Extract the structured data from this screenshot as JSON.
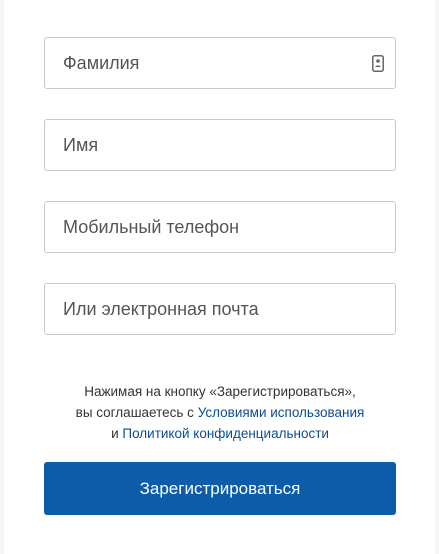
{
  "form": {
    "fields": [
      {
        "placeholder": "Фамилия",
        "value": ""
      },
      {
        "placeholder": "Имя",
        "value": ""
      },
      {
        "placeholder": "Мобильный телефон",
        "value": ""
      },
      {
        "placeholder": "Или электронная почта",
        "value": ""
      }
    ],
    "autofill_icon": "contact-card-icon"
  },
  "legal": {
    "line1": "Нажимая на кнопку «Зарегистрироваться»,",
    "line2_prefix": "вы соглашаетесь с",
    "terms_link": "Условиями использования",
    "line3_prefix": "и",
    "privacy_link": "Политикой конфиденциальности"
  },
  "submit": {
    "label": "Зарегистрироваться"
  },
  "colors": {
    "accent": "#0d5caa",
    "link": "#0d4c93",
    "background": "#f6f6f6",
    "field_border": "#c9c9c9"
  }
}
